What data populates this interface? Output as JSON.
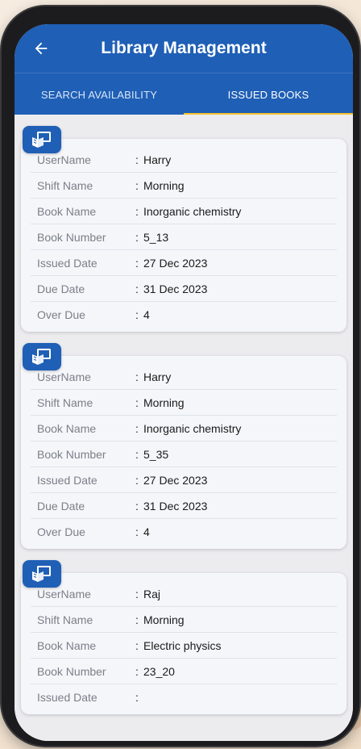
{
  "app": {
    "title": "Library Management"
  },
  "tabs": [
    {
      "label": "SEARCH AVAILABILITY",
      "active": false
    },
    {
      "label": "ISSUED BOOKS",
      "active": true
    }
  ],
  "field_labels": {
    "username": "UserName",
    "shift": "Shift Name",
    "book_name": "Book Name",
    "book_number": "Book Number",
    "issued": "Issued Date",
    "due": "Due Date",
    "overdue": "Over Due"
  },
  "separator": ":",
  "records": [
    {
      "username": "Harry",
      "shift": "Morning",
      "book_name": "Inorganic chemistry",
      "book_number": "5_13",
      "issued": "27 Dec 2023",
      "due": "31 Dec 2023",
      "overdue": "4"
    },
    {
      "username": "Harry",
      "shift": "Morning",
      "book_name": "Inorganic chemistry",
      "book_number": "5_35",
      "issued": "27 Dec 2023",
      "due": "31 Dec 2023",
      "overdue": "4"
    },
    {
      "username": "Raj",
      "shift": "Morning",
      "book_name": "Electric physics",
      "book_number": "23_20"
    }
  ],
  "colors": {
    "primary": "#1f5fb6",
    "tab_indicator": "#f2c12e",
    "card_bg": "#f5f6fa"
  },
  "icons": {
    "back": "arrow-left-icon",
    "badge": "book-reader-icon"
  }
}
